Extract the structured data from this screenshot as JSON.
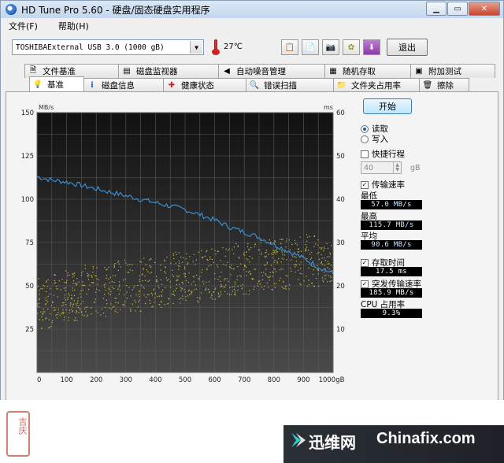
{
  "window": {
    "title": "HD Tune Pro 5.60 - 硬盘/固态硬盘实用程序",
    "minimize": "▭",
    "restore": "▭",
    "close": "✕"
  },
  "menu": [
    {
      "label": "文件(F)"
    },
    {
      "label": "帮助(H)"
    }
  ],
  "toolbar": {
    "drive": "TOSHIBAExternal USB 3.0 (1000 gB)",
    "temperature": "27℃",
    "exit_label": "退出",
    "buttons": [
      {
        "icon": "copy-info-icon"
      },
      {
        "icon": "copy-text-icon"
      },
      {
        "icon": "camera-icon"
      },
      {
        "icon": "options-icon"
      },
      {
        "icon": "save-down-icon"
      }
    ]
  },
  "tabs_top": [
    {
      "label": "文件基准",
      "icon": "file-bench-icon"
    },
    {
      "label": "磁盘监视器",
      "icon": "monitor-icon"
    },
    {
      "label": "自动噪音管理",
      "icon": "speaker-icon"
    },
    {
      "label": "随机存取",
      "icon": "random-icon"
    },
    {
      "label": "附加测试",
      "icon": "extra-test-icon"
    }
  ],
  "tabs_bottom": [
    {
      "label": "基准",
      "icon": "benchmark-icon",
      "active": true
    },
    {
      "label": "磁盘信息",
      "icon": "info-icon"
    },
    {
      "label": "健康状态",
      "icon": "health-icon"
    },
    {
      "label": "错误扫描",
      "icon": "scan-icon"
    },
    {
      "label": "文件夹占用率",
      "icon": "folder-icon"
    },
    {
      "label": "擦除",
      "icon": "erase-icon"
    }
  ],
  "side": {
    "start_label": "开始",
    "read_label": "读取",
    "write_label": "写入",
    "short_stroke_label": "快捷行程",
    "short_stroke_value": "40",
    "short_stroke_unit": "gB",
    "transfer_rate_label": "传输速率",
    "min_label": "最低",
    "min_value": "57.0 MB/s",
    "max_label": "最高",
    "max_value": "115.7 MB/s",
    "avg_label": "平均",
    "avg_value": "90.6 MB/s",
    "access_time_label": "存取时间",
    "access_time_value": "17.5 ms",
    "burst_rate_label": "突发传输速率",
    "burst_rate_value": "185.9 MB/s",
    "cpu_label": "CPU 占用率",
    "cpu_value": "9.3%"
  },
  "chart_data": {
    "type": "line",
    "x_unit": "gB",
    "y_left_unit": "MB/s",
    "y_right_unit": "ms",
    "xlim": [
      0,
      1000
    ],
    "ylim_left": [
      0,
      150
    ],
    "ylim_right": [
      0,
      60
    ],
    "x_ticks": [
      "0",
      "100",
      "200",
      "300",
      "400",
      "500",
      "600",
      "700",
      "800",
      "900",
      "1000gB"
    ],
    "y_left_ticks": [
      "25",
      "50",
      "75",
      "100",
      "125",
      "150"
    ],
    "y_right_ticks": [
      "10",
      "20",
      "30",
      "40",
      "50",
      "60"
    ],
    "grid": true,
    "series": [
      {
        "axis": "left",
        "color": "#3a8fd0",
        "x": [
          0,
          50,
          100,
          150,
          200,
          250,
          300,
          350,
          400,
          450,
          500,
          550,
          600,
          650,
          700,
          750,
          800,
          850,
          900,
          950,
          1000
        ],
        "y": [
          113,
          111,
          110,
          108,
          106,
          104,
          102,
          100,
          98,
          96,
          94,
          91,
          88,
          84,
          81,
          78,
          74,
          70,
          66,
          61,
          57
        ]
      },
      {
        "axis": "right",
        "kind": "scatter",
        "color": "#c8c040",
        "access_min_ms": [
          10,
          12,
          13,
          14,
          15,
          16,
          17,
          18,
          19,
          20,
          21
        ],
        "access_max_ms": [
          22,
          24,
          25,
          26,
          27,
          28,
          29,
          30,
          31,
          32,
          30
        ]
      }
    ]
  },
  "watermark": {
    "seal_text": "吉庆",
    "brand_cn": "迅维网",
    "brand_en": "Chinafix.com",
    "colors": {
      "seal": "#b94a3a",
      "brand_bg": "#2b2f36"
    }
  }
}
